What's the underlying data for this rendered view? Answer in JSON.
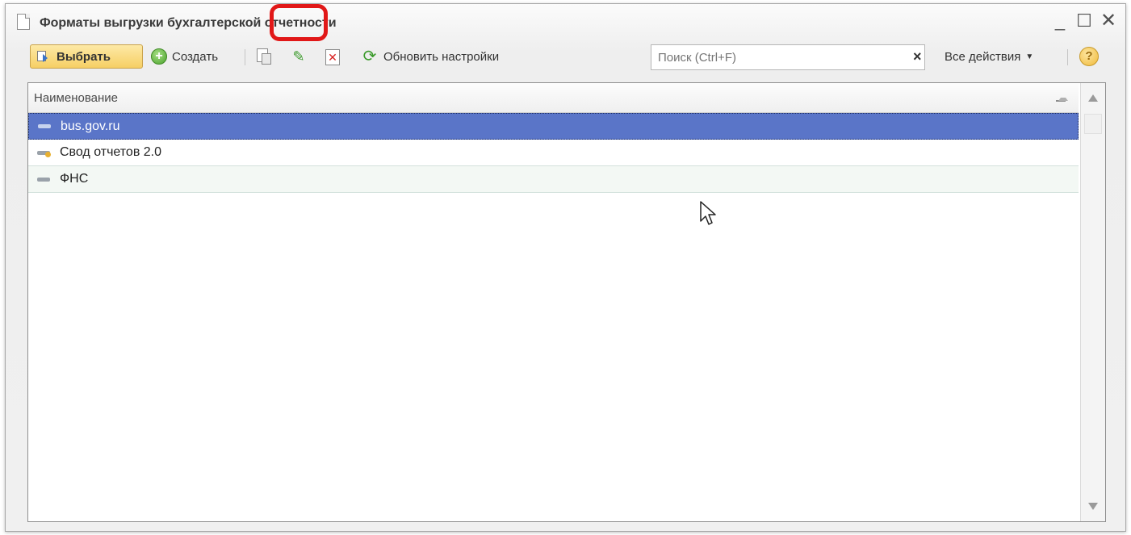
{
  "window": {
    "title": "Форматы выгрузки бухгалтерской отчетности",
    "controls": {
      "minimize": "_",
      "maximize": "☐",
      "close": "✕"
    }
  },
  "toolbar": {
    "select_label": "Выбрать",
    "create_label": "Создать",
    "refresh_label": "Обновить настройки",
    "search_placeholder": "Поиск (Ctrl+F)",
    "search_value": "",
    "clear_label": "×",
    "all_actions_label": "Все действия",
    "help_label": "?"
  },
  "list": {
    "column_header": "Наименование",
    "rows": [
      {
        "label": "bus.gov.ru",
        "selected": true
      },
      {
        "label": "Свод отчетов 2.0",
        "selected": false
      },
      {
        "label": "ФНС",
        "selected": false
      }
    ]
  },
  "annotation": {
    "highlight_color": "#e11818",
    "target": "edit-button"
  },
  "colors": {
    "selection": "#5a75c8",
    "accent_button": "#f6cf64"
  }
}
